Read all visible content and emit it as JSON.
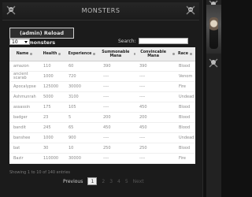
{
  "title": "MONSTERS",
  "reload_button": "(admin) Reload monsters",
  "length_select": "10",
  "search_label": "Search:",
  "columns": [
    "Name",
    "Health",
    "Experience",
    "Summonable Mana",
    "Convincable Mana",
    "Race"
  ],
  "rows": [
    [
      "amazon",
      "110",
      "60",
      "390",
      "390",
      "Blood"
    ],
    [
      "ancient scarab",
      "1000",
      "720",
      "----",
      "----",
      "Venom"
    ],
    [
      "Apocalypse",
      "125000",
      "30000",
      "----",
      "----",
      "Fire"
    ],
    [
      "Ashmunrah",
      "5000",
      "3100",
      "----",
      "----",
      "Undead"
    ],
    [
      "assassin",
      "175",
      "105",
      "----",
      "450",
      "Blood"
    ],
    [
      "badger",
      "23",
      "5",
      "200",
      "200",
      "Blood"
    ],
    [
      "bandit",
      "245",
      "65",
      "450",
      "450",
      "Blood"
    ],
    [
      "banshee",
      "1000",
      "900",
      "----",
      "----",
      "Undead"
    ],
    [
      "bat",
      "30",
      "10",
      "250",
      "250",
      "Blood"
    ],
    [
      "Bazir",
      "110000",
      "30000",
      "----",
      "----",
      "Fire"
    ]
  ],
  "info_text": "Showing 1 to 10 of 140 entries",
  "pager": {
    "previous": "Previous",
    "current": "1",
    "pages": [
      "2",
      "3",
      "4",
      "5"
    ],
    "next": "Next"
  }
}
